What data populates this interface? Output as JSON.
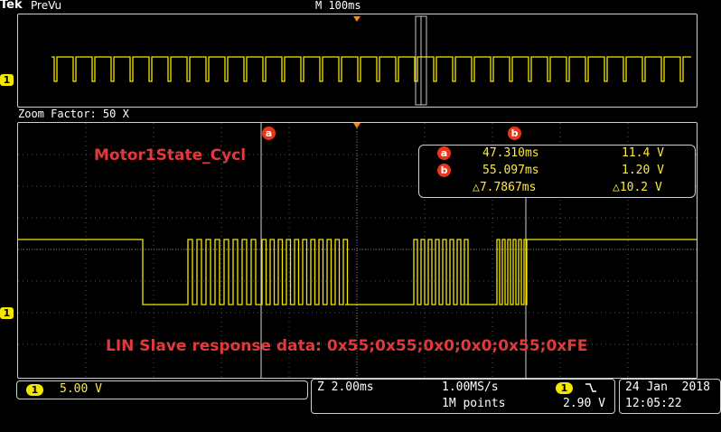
{
  "header": {
    "brand": "Tek",
    "mode": "PreVu",
    "timebase": "M 100ms"
  },
  "zoom": {
    "factor_label": "Zoom Factor: 50 X",
    "cursor_a": "a",
    "cursor_b": "b"
  },
  "channel_marker": "1",
  "measurements": {
    "a_label": "a",
    "b_label": "b",
    "a_time": "47.310ms",
    "a_volt": "11.4 V",
    "b_time": "55.097ms",
    "b_volt": "1.20 V",
    "delta_time": "△7.7867ms",
    "delta_volt": "△10.2 V"
  },
  "annotations": {
    "title": "Motor1State_Cycl",
    "data": "LIN Slave response data: 0x55;0x55;0x0;0x0;0x55;0xFE"
  },
  "readouts": {
    "channel_num": "1",
    "volts_per_div": "5.00 V",
    "zoom_timebase": "Z 2.00ms",
    "sample_rate": "1.00MS/s",
    "record_length": "1M points",
    "trigger_channel": "1",
    "trigger_slope_icon": "falling-edge-icon",
    "trigger_level": "2.90 V",
    "date": "24 Jan  2018",
    "time": "12:05:22"
  },
  "colors": {
    "trace": "#f5e800",
    "annotation": "#e03a3a",
    "cursor_marker": "#e8361c",
    "trigger_marker": "#f08a1c"
  }
}
